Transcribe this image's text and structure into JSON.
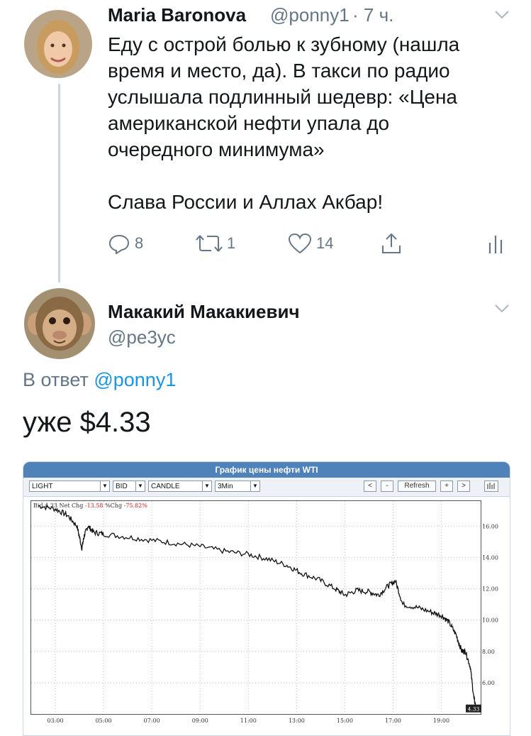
{
  "tweet1": {
    "author_name": "Maria Baronova",
    "handle": "@ponny1",
    "time": "· 7 ч.",
    "text_lines": [
      "Еду с острой болью к зубному (нашла",
      "время и место, да). В такси по радио",
      "услышала подлинный шедевр: «Цена",
      "американской нефти упала до",
      "очередного минимума»"
    ],
    "text_line_2": "Слава России и Аллах Акбар!",
    "replies": "8",
    "retweets": "1",
    "likes": "14"
  },
  "tweet2": {
    "author_name": "Макакий Макакиевич",
    "handle": "@pe3yc",
    "reply_prefix": "В ответ",
    "reply_handle": "@ponny1",
    "text": "уже $4.33"
  },
  "chart_widget": {
    "title": "График цены нефти WTI",
    "symbol": "LIGHT",
    "quote_type": "BID",
    "chart_style": "CANDLE",
    "interval": "3Min",
    "nav_prev": "<",
    "nav_minus": "-",
    "refresh": "Refresh",
    "nav_plus": "+",
    "nav_next": ">",
    "info_bid": "Bid 4.33",
    "info_netchg_label": "Net Chg",
    "info_netchg": "-13.58",
    "info_pctchg_label": "%Chg",
    "info_pctchg": "-75.82%",
    "last_price_label": "4.33"
  },
  "chart_data": {
    "type": "line",
    "x_ticks": [
      "03:00",
      "05:00",
      "07:00",
      "09:00",
      "11:00",
      "13:00",
      "15:00",
      "17:00",
      "19:00"
    ],
    "y_ticks": [
      "6.00",
      "8.00",
      "10.00",
      "12.00",
      "14.00",
      "16.00"
    ],
    "ylim": [
      4,
      17.6
    ],
    "x": [
      2.3,
      3.0,
      3.5,
      3.9,
      4.1,
      4.2,
      4.35,
      4.6,
      5.0,
      6.0,
      7.0,
      8.0,
      9.0,
      10.0,
      11.0,
      11.8,
      12.6,
      13.2,
      13.9,
      14.6,
      15.0,
      15.5,
      16.0,
      16.4,
      16.8,
      17.1,
      17.4,
      18.0,
      18.6,
      19.0,
      19.3,
      19.6,
      19.85,
      20.0,
      20.2,
      20.35,
      20.45
    ],
    "y": [
      17.3,
      17.1,
      16.7,
      16.0,
      14.6,
      15.4,
      16.0,
      15.6,
      15.5,
      15.3,
      15.1,
      14.9,
      14.7,
      14.4,
      14.2,
      13.9,
      13.5,
      13.0,
      12.6,
      12.0,
      11.6,
      11.9,
      11.8,
      11.6,
      12.2,
      12.5,
      11.0,
      10.8,
      10.5,
      10.3,
      9.9,
      9.1,
      8.0,
      8.0,
      7.0,
      5.0,
      4.33
    ],
    "last_value": 4.33
  }
}
